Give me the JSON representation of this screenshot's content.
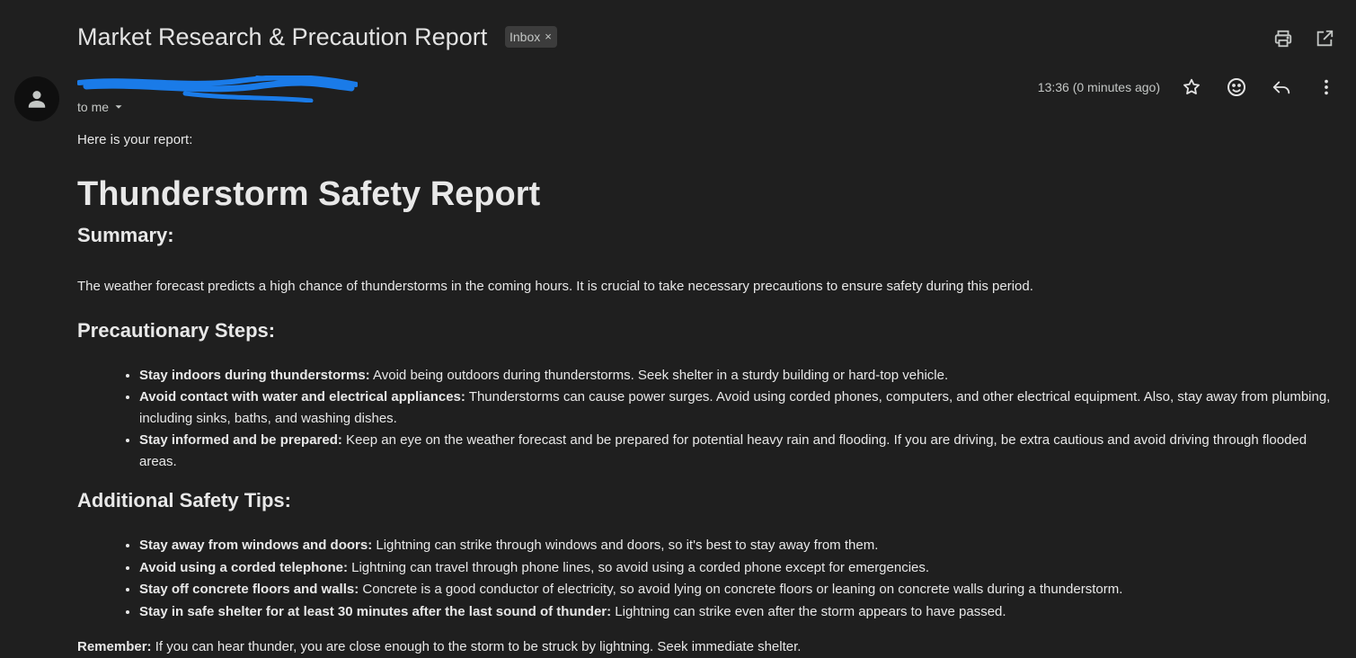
{
  "header": {
    "subject": "Market Research & Precaution Report",
    "label_chip": "Inbox",
    "label_remove_glyph": "×",
    "actions": [
      {
        "icon": "print-icon"
      },
      {
        "icon": "open-in-new-window-icon"
      }
    ]
  },
  "message": {
    "recipient_line": "to me",
    "timestamp": "13:36 (0 minutes ago)",
    "actions": [
      {
        "icon": "star-icon"
      },
      {
        "icon": "emoji-reaction-icon"
      },
      {
        "icon": "reply-icon"
      },
      {
        "icon": "more-vertical-icon"
      }
    ]
  },
  "body": {
    "intro": "Here is your report:",
    "title": "Thunderstorm Safety Report",
    "summary_heading": "Summary:",
    "summary_text": "The weather forecast predicts a high chance of thunderstorms in the coming hours. It is crucial to take necessary precautions to ensure safety during this period.",
    "steps_heading": "Precautionary Steps:",
    "steps": [
      {
        "bold": "Stay indoors during thunderstorms:",
        "text": " Avoid being outdoors during thunderstorms. Seek shelter in a sturdy building or hard-top vehicle."
      },
      {
        "bold": "Avoid contact with water and electrical appliances:",
        "text": " Thunderstorms can cause power surges. Avoid using corded phones, computers, and other electrical equipment. Also, stay away from plumbing, including sinks, baths, and washing dishes."
      },
      {
        "bold": "Stay informed and be prepared:",
        "text": " Keep an eye on the weather forecast and be prepared for potential heavy rain and flooding. If you are driving, be extra cautious and avoid driving through flooded areas."
      }
    ],
    "tips_heading": "Additional Safety Tips:",
    "tips": [
      {
        "bold": "Stay away from windows and doors:",
        "text": " Lightning can strike through windows and doors, so it's best to stay away from them."
      },
      {
        "bold": "Avoid using a corded telephone:",
        "text": " Lightning can travel through phone lines, so avoid using a corded phone except for emergencies."
      },
      {
        "bold": "Stay off concrete floors and walls:",
        "text": " Concrete is a good conductor of electricity, so avoid lying on concrete floors or leaning on concrete walls during a thunderstorm."
      },
      {
        "bold": "Stay in safe shelter for at least 30 minutes after the last sound of thunder:",
        "text": " Lightning can strike even after the storm appears to have passed."
      }
    ],
    "remember_bold": "Remember:",
    "remember_text": " If you can hear thunder, you are close enough to the storm to be struck by lightning. Seek immediate shelter."
  },
  "colors": {
    "background": "#1f1f1f",
    "text": "#e3e3e3",
    "secondary_text": "#c4c7c5",
    "chip_background": "#3c3c3c",
    "redaction_scribble": "#1a7be8"
  }
}
